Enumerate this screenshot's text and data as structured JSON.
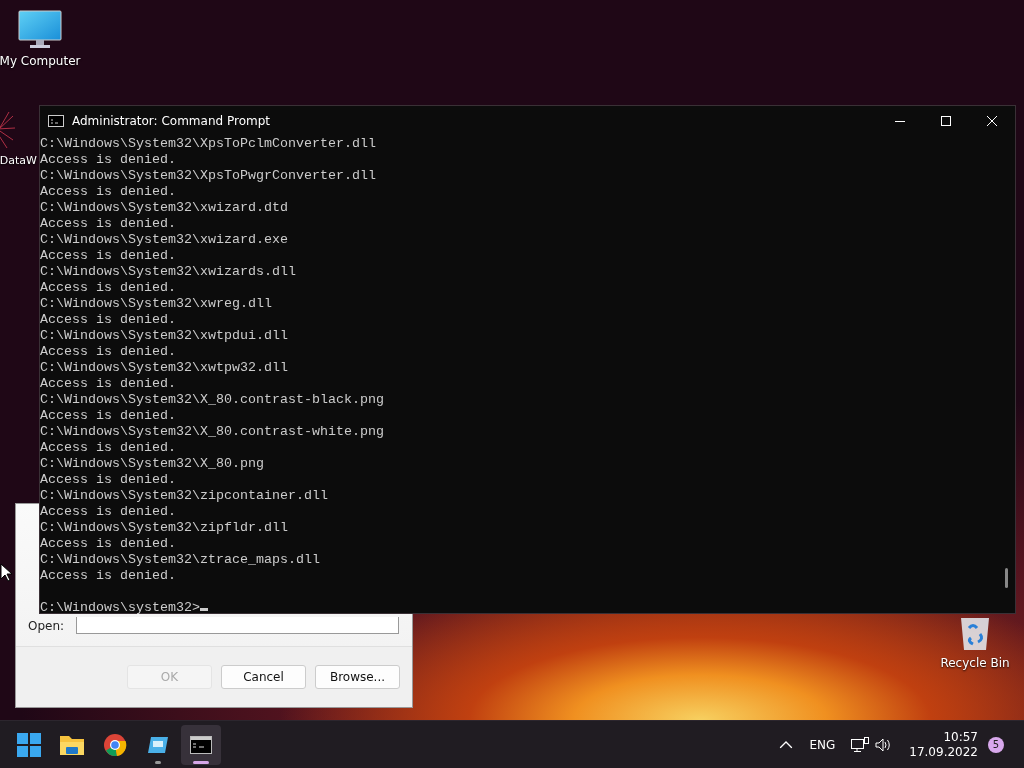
{
  "desktop_icons": [
    {
      "kind": "computer",
      "label": "My Computer"
    },
    {
      "kind": "shortcut",
      "label": "DataW"
    },
    {
      "kind": "bin",
      "label": "Recycle Bin"
    }
  ],
  "run_dialog": {
    "open_label": "Open:",
    "buttons": [
      {
        "label": "OK",
        "disabled": true
      },
      {
        "label": "Cancel",
        "disabled": false
      },
      {
        "label": "Browse...",
        "disabled": false
      }
    ]
  },
  "window": {
    "title": "Administrator: Command Prompt",
    "lines": [
      "C:\\Windows\\System32\\XpsToPclmConverter.dll",
      "Access is denied.",
      "C:\\Windows\\System32\\XpsToPwgrConverter.dll",
      "Access is denied.",
      "C:\\Windows\\System32\\xwizard.dtd",
      "Access is denied.",
      "C:\\Windows\\System32\\xwizard.exe",
      "Access is denied.",
      "C:\\Windows\\System32\\xwizards.dll",
      "Access is denied.",
      "C:\\Windows\\System32\\xwreg.dll",
      "Access is denied.",
      "C:\\Windows\\System32\\xwtpdui.dll",
      "Access is denied.",
      "C:\\Windows\\System32\\xwtpw32.dll",
      "Access is denied.",
      "C:\\Windows\\System32\\X_80.contrast-black.png",
      "Access is denied.",
      "C:\\Windows\\System32\\X_80.contrast-white.png",
      "Access is denied.",
      "C:\\Windows\\System32\\X_80.png",
      "Access is denied.",
      "C:\\Windows\\System32\\zipcontainer.dll",
      "Access is denied.",
      "C:\\Windows\\System32\\zipfldr.dll",
      "Access is denied.",
      "C:\\Windows\\System32\\ztrace_maps.dll",
      "Access is denied."
    ],
    "prompt": "C:\\Windows\\system32>"
  },
  "taskbar": {
    "apps": [
      {
        "kind": "start",
        "running": false,
        "selected": false
      },
      {
        "kind": "folder",
        "running": false,
        "selected": false
      },
      {
        "kind": "browser",
        "running": false,
        "selected": false
      },
      {
        "kind": "tablet",
        "running": true,
        "selected": false
      },
      {
        "kind": "terminal",
        "running": true,
        "selected": true
      }
    ],
    "language": "ENG",
    "time": "10:57",
    "date": "17.09.2022",
    "notification_count": "5"
  }
}
